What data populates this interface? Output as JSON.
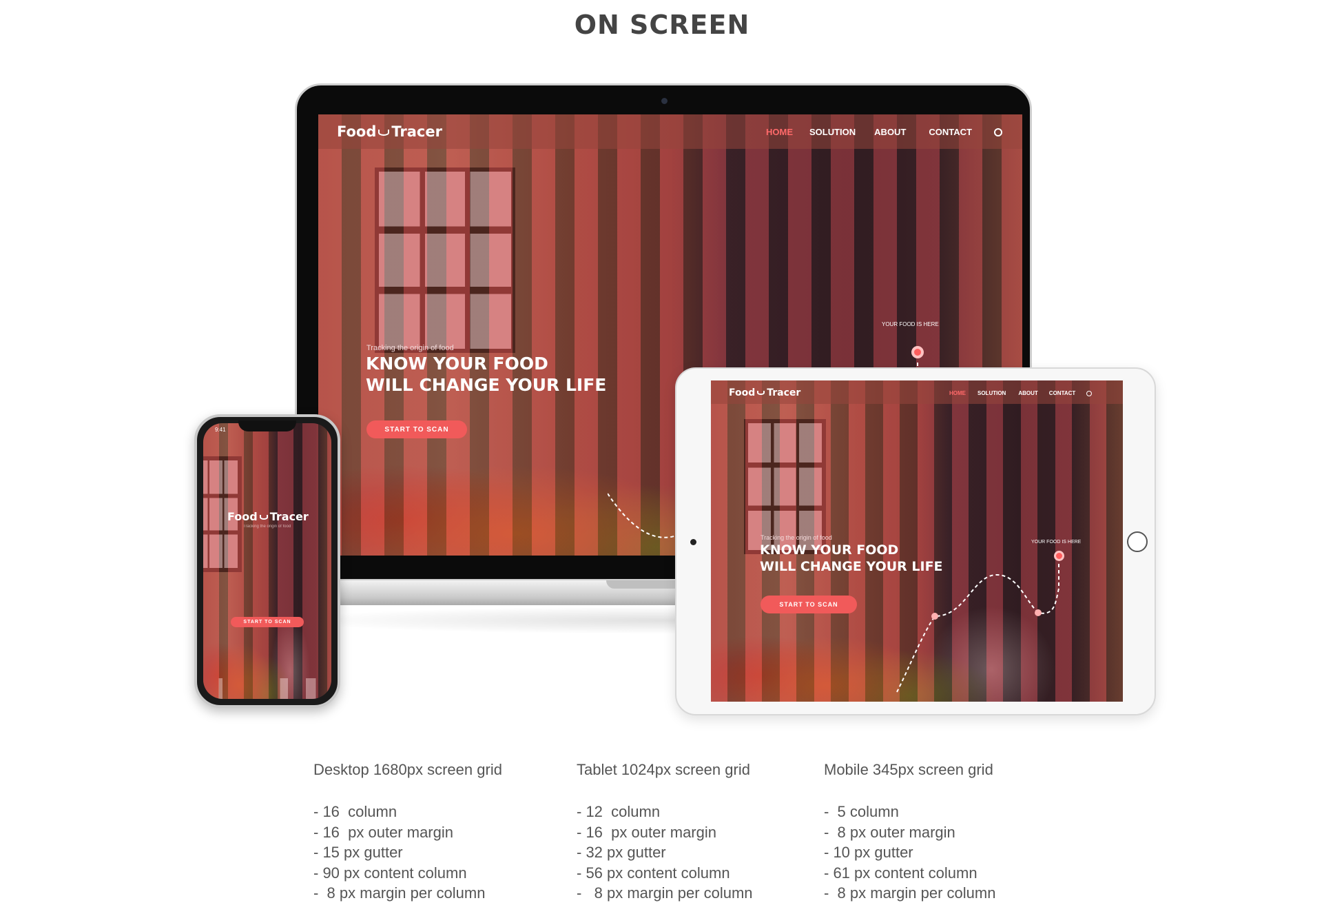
{
  "page": {
    "title": "ON SCREEN"
  },
  "site": {
    "logo_left": "Food",
    "logo_right": "Tracer",
    "nav": [
      "HOME",
      "SOLUTION",
      "ABOUT",
      "CONTACT"
    ],
    "active_nav": "HOME",
    "hero_subtitle": "Tracking the origin of food",
    "hero_line1": "KNOW YOUR FOOD",
    "hero_line2": "WILL CHANGE YOUR LIFE",
    "cta_label": "START TO SCAN",
    "pin_label": "YOUR FOOD IS HERE",
    "phone_subtitle": "Tracking the origin of food",
    "phone_time": "9:41"
  },
  "icons": {
    "search": "search-icon",
    "logo": "cup-icon"
  },
  "colors": {
    "accent": "#f15a5a",
    "overlay_column": "#d74650",
    "nav_active": "#ff6a6a",
    "text": "#555555"
  },
  "specs": [
    {
      "title": "Desktop  1680px screen grid",
      "lines": [
        "- 16  column",
        "- 16  px outer margin",
        "- 15 px gutter",
        "- 90 px content column",
        "-  8 px margin per column"
      ]
    },
    {
      "title": "Tablet  1024px screen grid",
      "lines": [
        "- 12  column",
        "- 16  px outer margin",
        "- 32 px gutter",
        "- 56 px content column",
        "-   8 px margin per column"
      ]
    },
    {
      "title": "Mobile  345px screen grid",
      "lines": [
        "-  5 column",
        "-  8 px outer margin",
        "- 10 px gutter",
        "- 61 px content column",
        "-  8 px margin per column"
      ]
    }
  ]
}
